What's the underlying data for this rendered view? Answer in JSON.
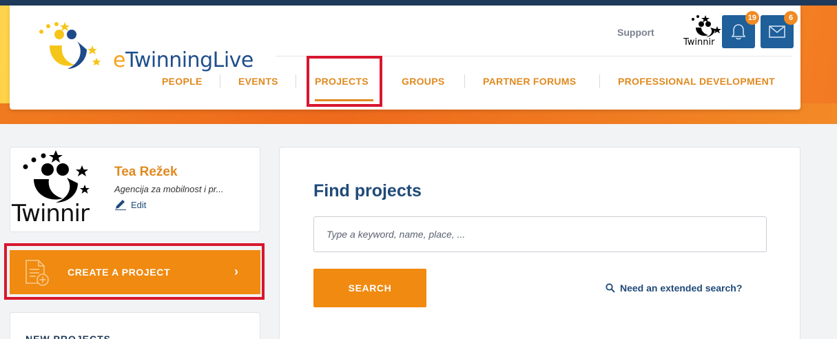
{
  "app": {
    "logo_prefix": "e",
    "logo_name": "TwinningLive",
    "mini_logo_text": "Twinnir"
  },
  "header": {
    "support_label": "Support",
    "notifications_count": "19",
    "messages_count": "6"
  },
  "nav": {
    "items": [
      {
        "label": "PEOPLE"
      },
      {
        "label": "EVENTS"
      },
      {
        "label": "PROJECTS"
      },
      {
        "label": "GROUPS"
      },
      {
        "label": "PARTNER FORUMS"
      },
      {
        "label": "PROFESSIONAL DEVELOPMENT"
      }
    ],
    "active": "PROJECTS"
  },
  "profile": {
    "name": "Tea Režek",
    "organization": "Agencija za mobilnost i pr...",
    "edit_label": "Edit",
    "avatar_text": "Twinnir"
  },
  "sidebar": {
    "create_label": "CREATE A PROJECT",
    "new_projects_title": "NEW PROJECTS"
  },
  "find": {
    "title": "Find projects",
    "placeholder": "Type a keyword, name, place, ...",
    "search_label": "SEARCH",
    "extended_label": "Need an extended search?"
  },
  "colors": {
    "accent_orange": "#f08a10",
    "nav_orange": "#e08a20",
    "navy": "#1f4a78",
    "highlight_red": "#d7172e",
    "badge": "#f08a23"
  },
  "icons": {
    "notifications": "bell-icon",
    "messages": "envelope-icon",
    "edit": "pencil-icon",
    "create": "document-plus-icon",
    "chevron": "chevron-right-icon",
    "search": "search-icon"
  }
}
